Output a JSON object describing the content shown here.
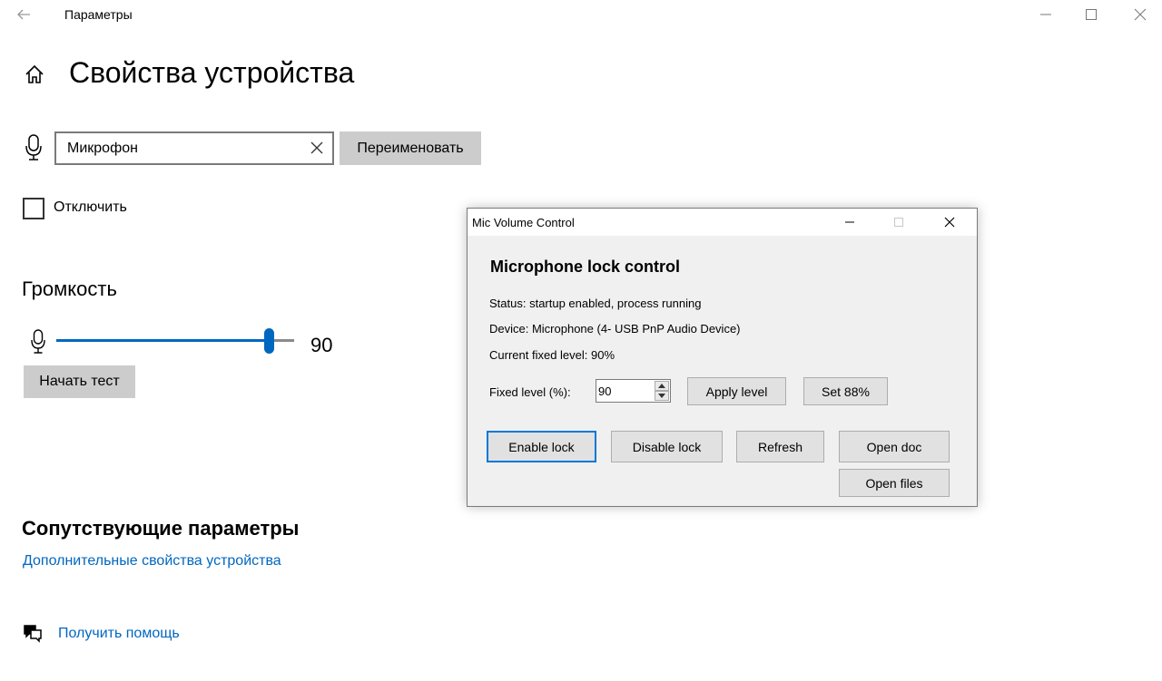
{
  "window": {
    "title": "Параметры"
  },
  "page": {
    "title": "Свойства устройства"
  },
  "device": {
    "name_value": "Микрофон",
    "rename_label": "Переименовать",
    "disable_label": "Отключить"
  },
  "volume": {
    "heading": "Громкость",
    "value": "90",
    "level_fraction": 0.9,
    "test_label": "Начать тест"
  },
  "related": {
    "heading": "Сопутствующие параметры",
    "link": "Дополнительные свойства устройства"
  },
  "help": {
    "link": "Получить помощь"
  },
  "dialog": {
    "title": "Mic Volume Control",
    "heading": "Microphone lock control",
    "status": "Status: startup enabled, process running",
    "device": "Device: Microphone (4- USB PnP Audio Device)",
    "current_level": "Current fixed level: 90%",
    "level_label": "Fixed level (%):",
    "level_value": "90",
    "apply_label": "Apply level",
    "set88_label": "Set 88%",
    "enable_label": "Enable lock",
    "disable_label": "Disable lock",
    "refresh_label": "Refresh",
    "open_doc_label": "Open doc",
    "open_files_label": "Open files"
  },
  "colors": {
    "accent": "#0067c0",
    "button_gray": "#cccccc",
    "dialog_bg": "#f0f0f0",
    "dialog_focus": "#0078d7"
  },
  "icons": {
    "back": "back-arrow-icon",
    "minimize": "minimize-icon",
    "maximize": "maximize-icon",
    "close": "close-icon",
    "home": "home-icon",
    "microphone": "microphone-icon",
    "clear": "clear-icon",
    "help": "help-chat-icon"
  }
}
